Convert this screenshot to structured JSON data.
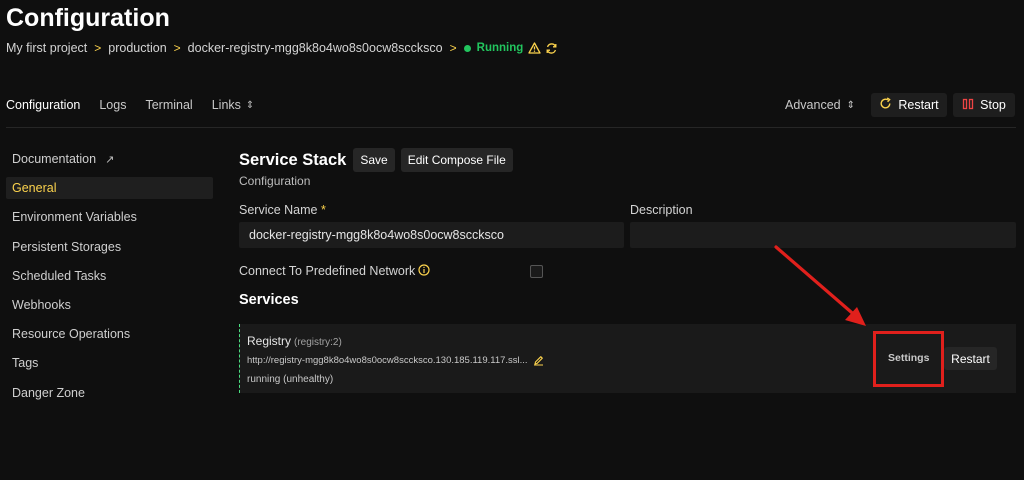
{
  "page": {
    "title": "Configuration"
  },
  "breadcrumb": {
    "project": "My first project",
    "environment": "production",
    "resource": "docker-registry-mgg8k8o4wo8s0ocw8sccksco",
    "separator": ">",
    "status": "Running",
    "status_color": "#22c55e"
  },
  "tabs": [
    {
      "label": "Configuration"
    },
    {
      "label": "Logs"
    },
    {
      "label": "Terminal"
    },
    {
      "label": "Links"
    }
  ],
  "toolbar": {
    "advanced_label": "Advanced",
    "restart_label": "Restart",
    "stop_label": "Stop",
    "updown_glyph": "⇕",
    "external_glyph": "↗"
  },
  "sidebar": {
    "items": [
      {
        "label": "Documentation"
      },
      {
        "label": "General"
      },
      {
        "label": "Environment Variables"
      },
      {
        "label": "Persistent Storages"
      },
      {
        "label": "Scheduled Tasks"
      },
      {
        "label": "Webhooks"
      },
      {
        "label": "Resource Operations"
      },
      {
        "label": "Tags"
      },
      {
        "label": "Danger Zone"
      }
    ]
  },
  "main": {
    "title": "Service Stack",
    "save_label": "Save",
    "edit_compose_label": "Edit Compose File",
    "subtitle": "Configuration",
    "service_name_label": "Service Name",
    "required_mark": "*",
    "service_name_value": "docker-registry-mgg8k8o4wo8s0ocw8sccksco",
    "description_label": "Description",
    "description_value": "",
    "network_label": "Connect To Predefined Network",
    "network_checked": false,
    "services_title": "Services"
  },
  "service": {
    "name": "Registry",
    "image": "(registry:2)",
    "url": "http://registry-mgg8k8o4wo8s0ocw8sccksco.130.185.119.117.ssl...",
    "status": "running (unhealthy)",
    "settings_label": "Settings",
    "restart_label": "Restart"
  },
  "colors": {
    "accent": "#fcd34d",
    "running": "#22c55e",
    "stop": "#ef4444",
    "annotation": "#e0201c"
  }
}
